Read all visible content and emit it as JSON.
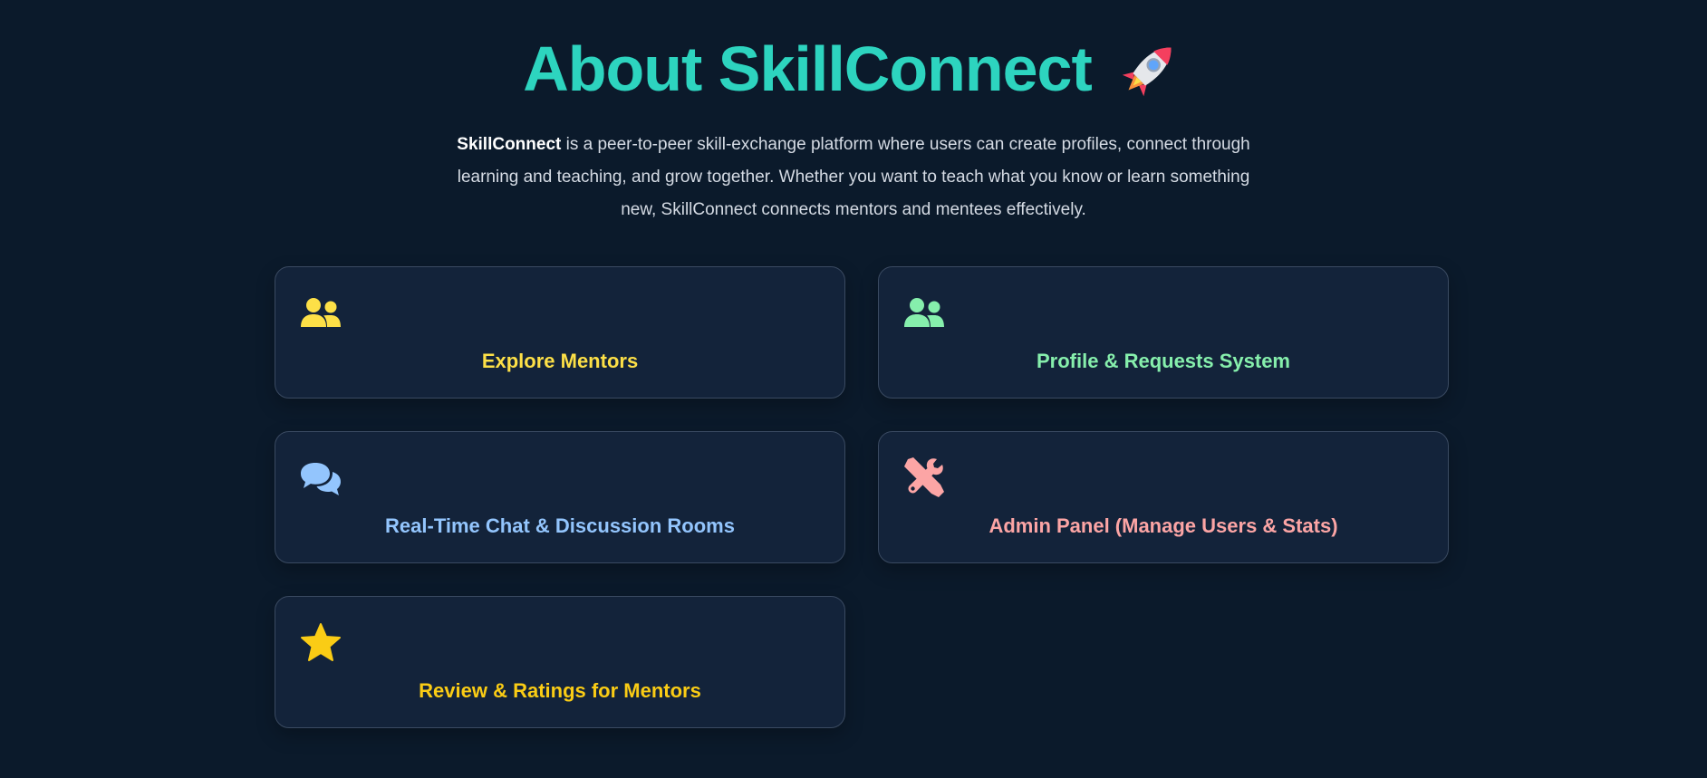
{
  "header": {
    "title": "About SkillConnect",
    "emoji_icon": "rocket-icon"
  },
  "intro": {
    "brand": "SkillConnect",
    "text": " is a peer-to-peer skill-exchange platform where users can create profiles, connect through learning and teaching, and grow together. Whether you want to teach what you know or learn something new, SkillConnect connects mentors and mentees effectively."
  },
  "colors": {
    "background": "#0b1a2b",
    "card_background": "#13233a",
    "title": "#2dd4bf"
  },
  "features": [
    {
      "label": "Explore Mentors",
      "icon": "users-icon",
      "color": "#fde047"
    },
    {
      "label": "Profile & Requests System",
      "icon": "users-icon",
      "color": "#86efac"
    },
    {
      "label": "Real-Time Chat & Discussion Rooms",
      "icon": "chat-bubbles-icon",
      "color": "#93c5fd"
    },
    {
      "label": "Admin Panel (Manage Users & Stats)",
      "icon": "tools-icon",
      "color": "#fca5a5"
    },
    {
      "label": "Review & Ratings for Mentors",
      "icon": "star-icon",
      "color": "#facc15"
    }
  ]
}
